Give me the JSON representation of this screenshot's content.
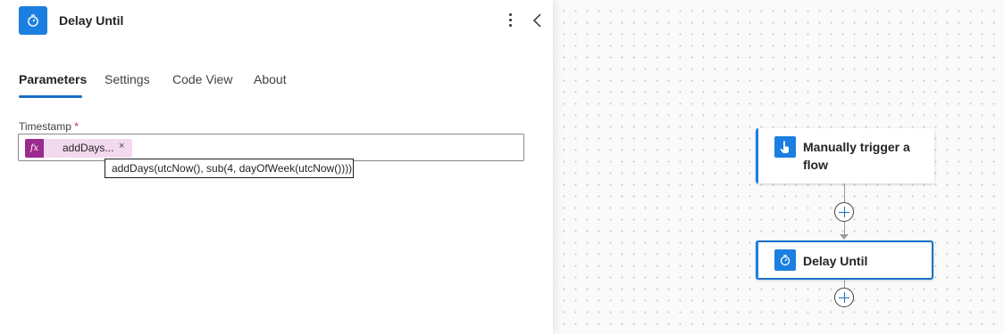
{
  "panel": {
    "title": "Delay Until",
    "header_icon": "timer-icon",
    "more_icon": "more-vertical-icon",
    "collapse_icon": "chevron-left-icon",
    "tabs": [
      {
        "label": "Parameters",
        "active": true
      },
      {
        "label": "Settings",
        "active": false
      },
      {
        "label": "Code View",
        "active": false
      },
      {
        "label": "About",
        "active": false
      }
    ],
    "field": {
      "label": "Timestamp",
      "required_mark": "*",
      "token": {
        "icon": "fx",
        "text": "addDays...",
        "remove": "×"
      },
      "tooltip": "addDays(utcNow(), sub(4, dayOfWeek(utcNow())))"
    }
  },
  "canvas": {
    "nodes": [
      {
        "label": "Manually trigger a flow",
        "icon": "touch-trigger-icon"
      },
      {
        "label": "Delay Until",
        "icon": "timer-icon",
        "selected": true
      }
    ]
  },
  "colors": {
    "accent": "#1a7fe0",
    "tab_underline": "#1a6fc9",
    "token_bg": "#f3d9ef",
    "token_icon_bg": "#9b2a8d",
    "required": "#c4314b"
  }
}
